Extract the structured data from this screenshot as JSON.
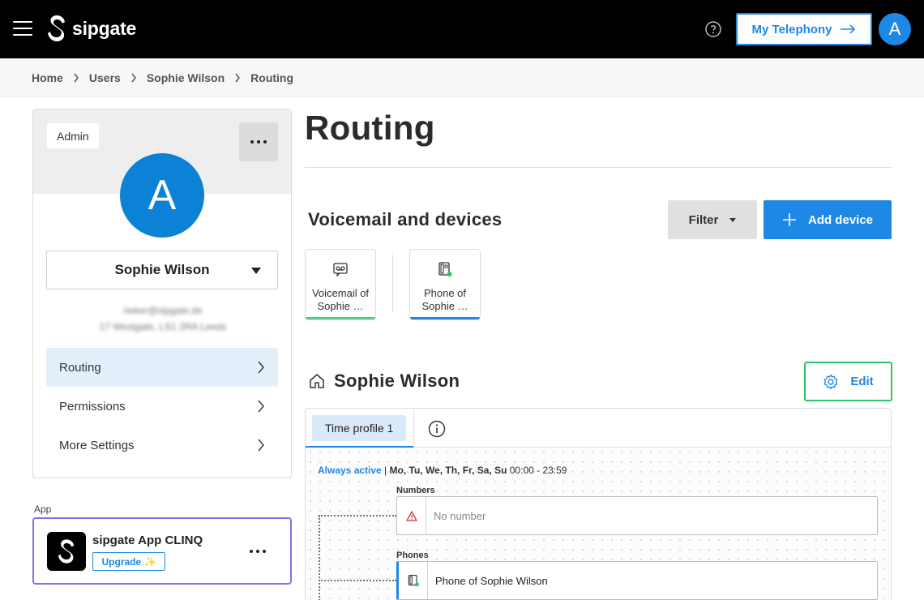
{
  "header": {
    "logo_text": "sipgate",
    "telephony_button": "My Telephony",
    "avatar_letter": "A"
  },
  "breadcrumb": [
    "Home",
    "Users",
    "Sophie Wilson",
    "Routing"
  ],
  "user_card": {
    "role_badge": "Admin",
    "avatar_letter": "A",
    "user_name": "Sophie Wilson",
    "email": "rieker@sipgate.de",
    "address": "17 Westgate, LS1 2RA Leeds",
    "nav": [
      {
        "label": "Routing",
        "active": true
      },
      {
        "label": "Permissions",
        "active": false
      },
      {
        "label": "More Settings",
        "active": false
      }
    ]
  },
  "app_section": {
    "label": "App",
    "app_name": "sipgate App CLINQ",
    "upgrade_label": "Upgrade ✨"
  },
  "main": {
    "title": "Routing",
    "section_title": "Voicemail and devices",
    "filter_label": "Filter",
    "add_device_label": "Add device",
    "devices": [
      {
        "label": "Voicemail of Sophie …",
        "icon": "voicemail-icon",
        "accent": "#4cd07d"
      },
      {
        "label": "Phone of Sophie …",
        "icon": "desk-phone-icon",
        "accent": "#1e88e5"
      }
    ],
    "owner_name": "Sophie Wilson",
    "edit_label": "Edit",
    "tab_label": "Time profile 1",
    "schedule": {
      "status": "Always active",
      "separator": " | ",
      "days": "Mo, Tu, We, Th, Fr, Sa, Su",
      "time": " 00:00 - 23:59"
    },
    "numbers_label": "Numbers",
    "numbers_value": "No number",
    "phones_label": "Phones",
    "phones_value": "Phone of Sophie Wilson"
  },
  "colors": {
    "brand_blue": "#1e88e5",
    "accent_green": "#2bc46d",
    "app_border_purple": "#8d6ee8",
    "warning_red": "#d32f2f"
  }
}
